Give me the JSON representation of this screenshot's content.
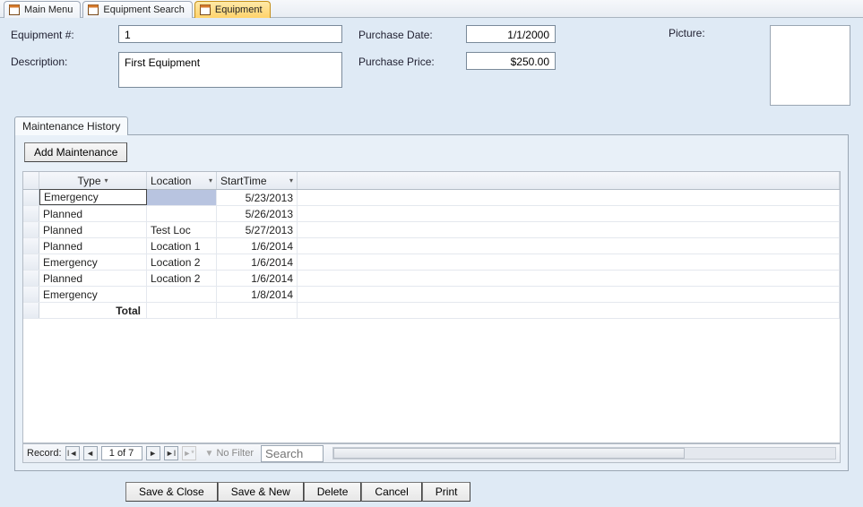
{
  "tabs": [
    {
      "label": "Main Menu",
      "active": false
    },
    {
      "label": "Equipment Search",
      "active": false
    },
    {
      "label": "Equipment",
      "active": true
    }
  ],
  "form": {
    "equipment_no_label": "Equipment #:",
    "equipment_no_value": "1",
    "description_label": "Description:",
    "description_value": "First Equipment",
    "purchase_date_label": "Purchase Date:",
    "purchase_date_value": "1/1/2000",
    "purchase_price_label": "Purchase Price:",
    "purchase_price_value": "$250.00",
    "picture_label": "Picture:"
  },
  "subtab": {
    "label": "Maintenance History",
    "add_btn": "Add Maintenance"
  },
  "grid": {
    "columns": {
      "type": "Type",
      "location": "Location",
      "starttime": "StartTime"
    },
    "rows": [
      {
        "type": "Emergency",
        "location": "",
        "start": "5/23/2013"
      },
      {
        "type": "Planned",
        "location": "",
        "start": "5/26/2013"
      },
      {
        "type": "Planned",
        "location": "Test Loc",
        "start": "5/27/2013"
      },
      {
        "type": "Planned",
        "location": "Location 1",
        "start": "1/6/2014"
      },
      {
        "type": "Emergency",
        "location": "Location 2",
        "start": "1/6/2014"
      },
      {
        "type": "Planned",
        "location": "Location 2",
        "start": "1/6/2014"
      },
      {
        "type": "Emergency",
        "location": "",
        "start": "1/8/2014"
      }
    ],
    "total_label": "Total"
  },
  "recnav": {
    "label": "Record:",
    "position": "1 of 7",
    "nofilter": "No Filter",
    "search_placeholder": "Search"
  },
  "footer": {
    "save_close": "Save & Close",
    "save_new": "Save & New",
    "delete": "Delete",
    "cancel": "Cancel",
    "print": "Print"
  }
}
